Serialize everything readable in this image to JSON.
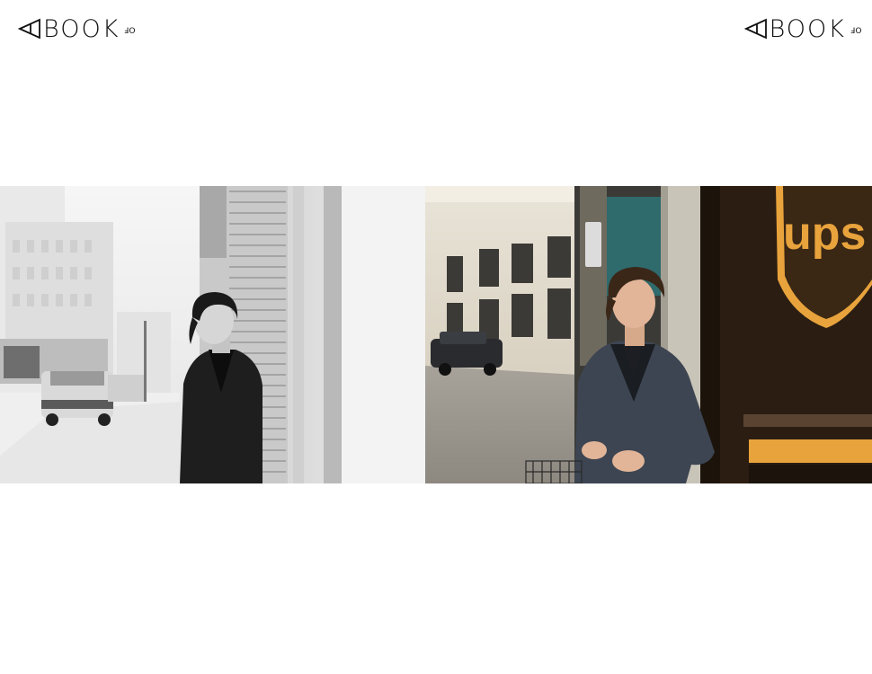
{
  "header": {
    "logo_left": {
      "word": "BOOK",
      "superscript": "OF"
    },
    "logo_right": {
      "word": "BOOK",
      "superscript": "OF"
    }
  },
  "spread": {
    "left_photo": {
      "icon": "photo-street-bw",
      "tone": "black-and-white"
    },
    "right_photo": {
      "icon": "photo-street-color",
      "tone": "color",
      "truck_badge_text": "ups"
    }
  },
  "colors": {
    "background": "#ffffff",
    "logo": "#111111",
    "ups_brown": "#2b1d12",
    "ups_gold": "#e8a33c"
  }
}
